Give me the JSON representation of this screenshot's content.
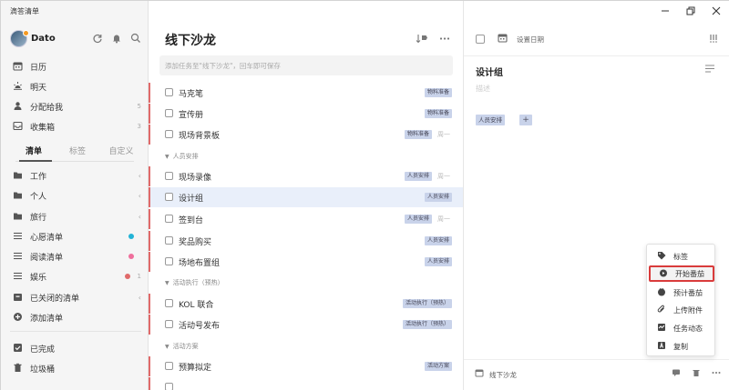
{
  "app": {
    "title": "滴答清单"
  },
  "user": {
    "name": "Dato"
  },
  "sidebar": {
    "smart_lists": [
      {
        "label": "日历",
        "icon": "calendar-icon"
      },
      {
        "label": "明天",
        "icon": "sunrise-icon"
      },
      {
        "label": "分配给我",
        "icon": "person-icon",
        "count": "5"
      },
      {
        "label": "收集箱",
        "icon": "inbox-icon",
        "count": "3"
      }
    ],
    "tabs": [
      {
        "label": "清单",
        "active": true
      },
      {
        "label": "标签"
      },
      {
        "label": "自定义"
      }
    ],
    "lists": [
      {
        "label": "工作",
        "icon": "folder-icon",
        "chevron": "‹"
      },
      {
        "label": "个人",
        "icon": "folder-icon",
        "chevron": "‹"
      },
      {
        "label": "旅行",
        "icon": "folder-icon",
        "chevron": "‹"
      },
      {
        "label": "心愿清单",
        "icon": "list-icon",
        "dot": "#22b3d6"
      },
      {
        "label": "阅读清单",
        "icon": "list-icon",
        "dot": "#ef6f9c"
      },
      {
        "label": "娱乐",
        "icon": "list-icon",
        "dot": "#e06a6a",
        "count": "1"
      },
      {
        "label": "已关闭的清单",
        "icon": "archive-icon",
        "chevron": "‹"
      },
      {
        "label": "添加清单",
        "icon": "add-icon"
      }
    ],
    "bottom": [
      {
        "label": "已完成",
        "icon": "checked-box-icon"
      },
      {
        "label": "垃圾桶",
        "icon": "trash-icon"
      }
    ]
  },
  "list": {
    "title": "线下沙龙",
    "add_placeholder": "添加任务至\"线下沙龙\"，回车即可保存",
    "groups": [
      {
        "tasks": [
          {
            "name": "马克笔",
            "tag": "物料准备",
            "due": ""
          },
          {
            "name": "宣传册",
            "tag": "物料准备",
            "due": ""
          },
          {
            "name": "现场背景板",
            "tag": "物料准备",
            "due": "周一"
          }
        ]
      },
      {
        "section": "人员安排",
        "tasks": [
          {
            "name": "现场录像",
            "tag": "人员安排",
            "due": "周一"
          },
          {
            "name": "设计组",
            "tag": "人员安排",
            "due": "",
            "selected": true
          },
          {
            "name": "签到台",
            "tag": "人员安排",
            "due": "周一"
          },
          {
            "name": "奖品购买",
            "tag": "人员安排",
            "due": ""
          },
          {
            "name": "场地布置组",
            "tag": "人员安排",
            "due": ""
          }
        ]
      },
      {
        "section": "活动执行（预热）",
        "tasks": [
          {
            "name": "KOL 联合",
            "tag": "活动执行（预热）",
            "due": ""
          },
          {
            "name": "活动号发布",
            "tag": "活动执行（预热）",
            "due": ""
          }
        ]
      },
      {
        "section": "活动方案",
        "tasks": [
          {
            "name": "预算拟定",
            "tag": "活动方案",
            "due": ""
          }
        ]
      }
    ]
  },
  "detail": {
    "set_date": "设置日期",
    "title": "设计组",
    "description_placeholder": "描述",
    "tag": "人员安排",
    "tag_add": "+",
    "footer_list": "线下沙龙"
  },
  "context_menu": {
    "items": [
      {
        "label": "标签",
        "icon": "tag-icon"
      },
      {
        "label": "开始番茄",
        "icon": "pomodoro-icon",
        "highlighted": true
      },
      {
        "label": "预计番茄",
        "icon": "pomodoro-estimate-icon"
      },
      {
        "label": "上传附件",
        "icon": "paperclip-icon"
      },
      {
        "label": "任务动态",
        "icon": "activity-icon"
      },
      {
        "label": "复制",
        "icon": "copy-icon"
      }
    ]
  },
  "colors": {
    "priority": "#e06a6a",
    "tag_bg": "#c9d3ea",
    "selected_row": "#e9effa",
    "highlight_border": "#d93b3b"
  }
}
